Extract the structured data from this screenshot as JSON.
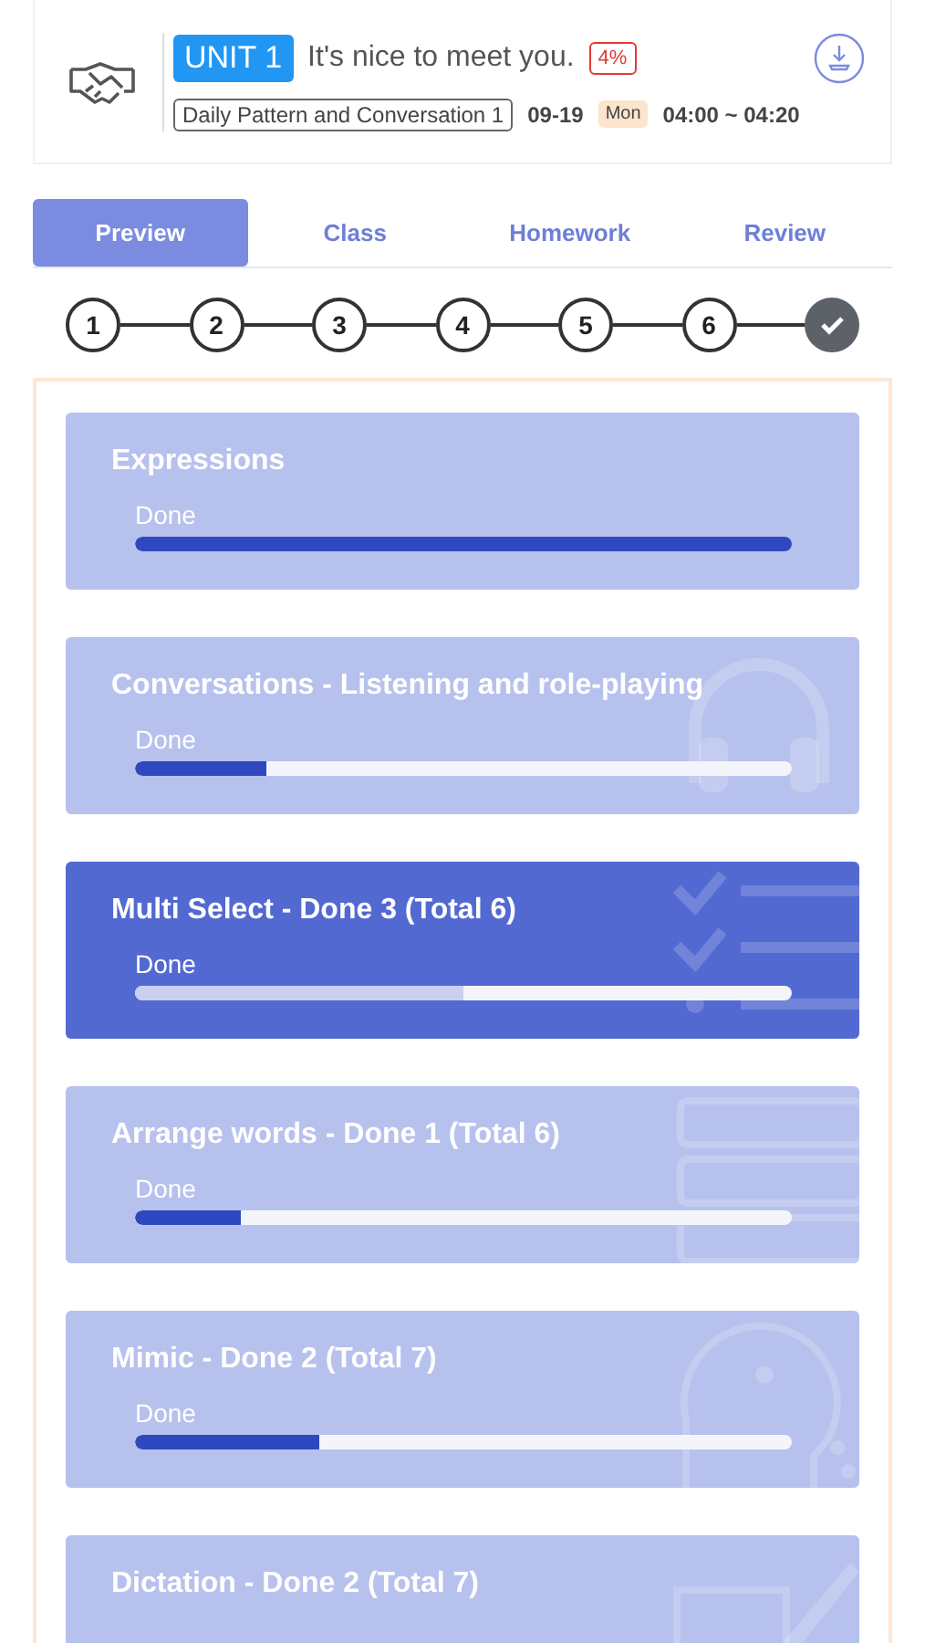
{
  "lesson": {
    "unit": "UNIT 1",
    "title": "It's nice to meet you.",
    "progress": "4%",
    "course": "Daily Pattern and Conversation 1",
    "date": "09-19",
    "weekday": "Mon",
    "time": "04:00 ~ 04:20"
  },
  "tabs": [
    {
      "label": "Preview",
      "selected": true
    },
    {
      "label": "Class",
      "selected": false
    },
    {
      "label": "Homework",
      "selected": false
    },
    {
      "label": "Review",
      "selected": false
    }
  ],
  "steps": [
    {
      "kind": "number",
      "label": "1",
      "done": false
    },
    {
      "kind": "number",
      "label": "2",
      "done": false
    },
    {
      "kind": "number",
      "label": "3",
      "done": false
    },
    {
      "kind": "number",
      "label": "4",
      "done": false
    },
    {
      "kind": "number",
      "label": "5",
      "done": false
    },
    {
      "kind": "number",
      "label": "6",
      "done": false
    },
    {
      "kind": "check",
      "done": true
    }
  ],
  "activities": [
    {
      "kind": "plain",
      "title": "Expressions",
      "label": "Done",
      "level": 1.0,
      "selected": false
    },
    {
      "kind": "listening",
      "title": "Conversations - Listening and role-playing",
      "label": "Done",
      "level": 0.2,
      "selected": false
    },
    {
      "kind": "select",
      "title": "Multi Select - Done 3 (Total 6)",
      "label": "Done",
      "level": 0.5,
      "selected": true
    },
    {
      "kind": "arrange",
      "title": "Arrange words - Done 1 (Total 6)",
      "label": "Done",
      "level": 0.16,
      "selected": false
    },
    {
      "kind": "mimic",
      "title": "Mimic - Done 2 (Total 7)",
      "label": "Done",
      "level": 0.28,
      "selected": false
    },
    {
      "kind": "dictation",
      "title": "Dictation - Done 2 (Total 7)",
      "selected": false
    }
  ]
}
